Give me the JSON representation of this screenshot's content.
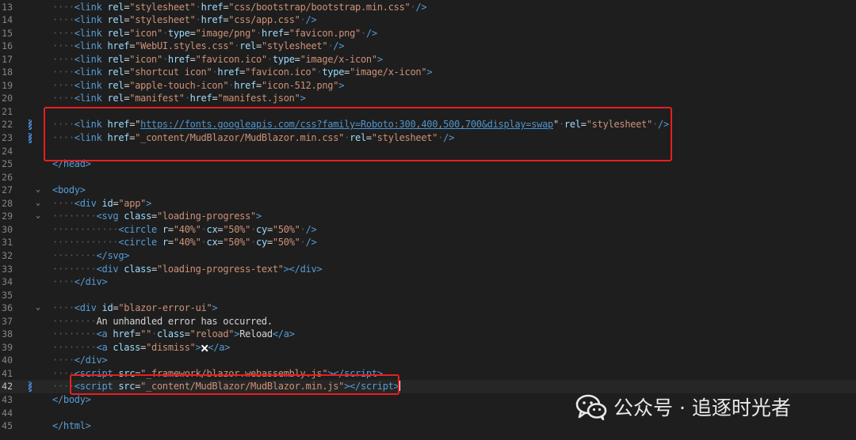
{
  "editor": {
    "lines": [
      {
        "num": "13",
        "mod": false,
        "fold": "",
        "ind": 1,
        "tokens": [
          [
            "b",
            "<"
          ],
          [
            "b",
            "link "
          ],
          [
            "an",
            "rel"
          ],
          [
            "t",
            "="
          ],
          [
            "av",
            "\"stylesheet\""
          ],
          [
            "w",
            "·"
          ],
          [
            "an",
            "href"
          ],
          [
            "t",
            "="
          ],
          [
            "av",
            "\"css/bootstrap/bootstrap.min.css\""
          ],
          [
            "w",
            "·"
          ],
          [
            "b",
            "/>"
          ]
        ]
      },
      {
        "num": "14",
        "mod": false,
        "fold": "",
        "ind": 1,
        "tokens": [
          [
            "b",
            "<"
          ],
          [
            "b",
            "link "
          ],
          [
            "an",
            "rel"
          ],
          [
            "t",
            "="
          ],
          [
            "av",
            "\"stylesheet\""
          ],
          [
            "w",
            "·"
          ],
          [
            "an",
            "href"
          ],
          [
            "t",
            "="
          ],
          [
            "av",
            "\"css/app.css\""
          ],
          [
            "w",
            "·"
          ],
          [
            "b",
            "/>"
          ]
        ]
      },
      {
        "num": "15",
        "mod": false,
        "fold": "",
        "ind": 1,
        "tokens": [
          [
            "b",
            "<"
          ],
          [
            "b",
            "link "
          ],
          [
            "an",
            "rel"
          ],
          [
            "t",
            "="
          ],
          [
            "av",
            "\"icon\""
          ],
          [
            "w",
            "·"
          ],
          [
            "an",
            "type"
          ],
          [
            "t",
            "="
          ],
          [
            "av",
            "\"image/png\""
          ],
          [
            "w",
            "·"
          ],
          [
            "an",
            "href"
          ],
          [
            "t",
            "="
          ],
          [
            "av",
            "\"favicon.png\""
          ],
          [
            "w",
            "·"
          ],
          [
            "b",
            "/>"
          ]
        ]
      },
      {
        "num": "16",
        "mod": false,
        "fold": "",
        "ind": 1,
        "tokens": [
          [
            "b",
            "<"
          ],
          [
            "b",
            "link "
          ],
          [
            "an",
            "href"
          ],
          [
            "t",
            "="
          ],
          [
            "av",
            "\"WebUI.styles.css\""
          ],
          [
            "w",
            "·"
          ],
          [
            "an",
            "rel"
          ],
          [
            "t",
            "="
          ],
          [
            "av",
            "\"stylesheet\""
          ],
          [
            "w",
            "·"
          ],
          [
            "b",
            "/>"
          ]
        ]
      },
      {
        "num": "17",
        "mod": false,
        "fold": "",
        "ind": 1,
        "tokens": [
          [
            "b",
            "<"
          ],
          [
            "b",
            "link "
          ],
          [
            "an",
            "rel"
          ],
          [
            "t",
            "="
          ],
          [
            "av",
            "\"icon\""
          ],
          [
            "w",
            "·"
          ],
          [
            "an",
            "href"
          ],
          [
            "t",
            "="
          ],
          [
            "av",
            "\"favicon.ico\""
          ],
          [
            "w",
            "·"
          ],
          [
            "an",
            "type"
          ],
          [
            "t",
            "="
          ],
          [
            "av",
            "\"image/x-icon\""
          ],
          [
            "b",
            ">"
          ]
        ]
      },
      {
        "num": "18",
        "mod": false,
        "fold": "",
        "ind": 1,
        "tokens": [
          [
            "b",
            "<"
          ],
          [
            "b",
            "link "
          ],
          [
            "an",
            "rel"
          ],
          [
            "t",
            "="
          ],
          [
            "av",
            "\"shortcut icon\""
          ],
          [
            "w",
            "·"
          ],
          [
            "an",
            "href"
          ],
          [
            "t",
            "="
          ],
          [
            "av",
            "\"favicon.ico\""
          ],
          [
            "w",
            "·"
          ],
          [
            "an",
            "type"
          ],
          [
            "t",
            "="
          ],
          [
            "av",
            "\"image/x-icon\""
          ],
          [
            "b",
            ">"
          ]
        ]
      },
      {
        "num": "19",
        "mod": false,
        "fold": "",
        "ind": 1,
        "tokens": [
          [
            "b",
            "<"
          ],
          [
            "b",
            "link "
          ],
          [
            "an",
            "rel"
          ],
          [
            "t",
            "="
          ],
          [
            "av",
            "\"apple-touch-icon\""
          ],
          [
            "w",
            "·"
          ],
          [
            "an",
            "href"
          ],
          [
            "t",
            "="
          ],
          [
            "av",
            "\"icon-512.png\""
          ],
          [
            "b",
            ">"
          ]
        ]
      },
      {
        "num": "20",
        "mod": false,
        "fold": "",
        "ind": 1,
        "tokens": [
          [
            "b",
            "<"
          ],
          [
            "b",
            "link "
          ],
          [
            "an",
            "rel"
          ],
          [
            "t",
            "="
          ],
          [
            "av",
            "\"manifest\""
          ],
          [
            "w",
            "·"
          ],
          [
            "an",
            "href"
          ],
          [
            "t",
            "="
          ],
          [
            "av",
            "\"manifest.json\""
          ],
          [
            "b",
            ">"
          ]
        ]
      },
      {
        "num": "21",
        "mod": false,
        "fold": "",
        "ind": 0,
        "tokens": []
      },
      {
        "num": "22",
        "mod": true,
        "fold": "",
        "ind": 1,
        "tokens": [
          [
            "b",
            "<"
          ],
          [
            "b",
            "link "
          ],
          [
            "an",
            "href"
          ],
          [
            "t",
            "="
          ],
          [
            "t",
            "\""
          ],
          [
            "u",
            "https://fonts.googleapis.com/css?family=Roboto:300,400,500,700&display=swap"
          ],
          [
            "t",
            "\""
          ],
          [
            "w",
            "·"
          ],
          [
            "an",
            "rel"
          ],
          [
            "t",
            "="
          ],
          [
            "av",
            "\"stylesheet\""
          ],
          [
            "w",
            "·"
          ],
          [
            "b",
            "/>"
          ]
        ]
      },
      {
        "num": "23",
        "mod": true,
        "fold": "",
        "ind": 1,
        "tokens": [
          [
            "b",
            "<"
          ],
          [
            "b",
            "link "
          ],
          [
            "an",
            "href"
          ],
          [
            "t",
            "="
          ],
          [
            "av",
            "\"_content/MudBlazor/MudBlazor.min.css\""
          ],
          [
            "w",
            "·"
          ],
          [
            "an",
            "rel"
          ],
          [
            "t",
            "="
          ],
          [
            "av",
            "\"stylesheet\""
          ],
          [
            "w",
            "·"
          ],
          [
            "b",
            "/>"
          ]
        ]
      },
      {
        "num": "24",
        "mod": false,
        "fold": "",
        "ind": 0,
        "tokens": []
      },
      {
        "num": "25",
        "mod": false,
        "fold": "",
        "ind": 0,
        "tokens": [
          [
            "b",
            "</"
          ],
          [
            "b",
            "head"
          ],
          [
            "b",
            ">"
          ]
        ]
      },
      {
        "num": "26",
        "mod": false,
        "fold": "",
        "ind": 0,
        "tokens": []
      },
      {
        "num": "27",
        "mod": false,
        "fold": "⌄",
        "ind": 0,
        "tokens": [
          [
            "b",
            "<"
          ],
          [
            "b",
            "body"
          ],
          [
            "b",
            ">"
          ]
        ]
      },
      {
        "num": "28",
        "mod": false,
        "fold": "⌄",
        "ind": 1,
        "tokens": [
          [
            "b",
            "<"
          ],
          [
            "b",
            "div "
          ],
          [
            "an",
            "id"
          ],
          [
            "t",
            "="
          ],
          [
            "av",
            "\"app\""
          ],
          [
            "b",
            ">"
          ]
        ]
      },
      {
        "num": "29",
        "mod": false,
        "fold": "⌄",
        "ind": 2,
        "tokens": [
          [
            "b",
            "<"
          ],
          [
            "b",
            "svg "
          ],
          [
            "an",
            "class"
          ],
          [
            "t",
            "="
          ],
          [
            "av",
            "\"loading-progress\""
          ],
          [
            "b",
            ">"
          ]
        ]
      },
      {
        "num": "30",
        "mod": false,
        "fold": "",
        "ind": 3,
        "tokens": [
          [
            "b",
            "<"
          ],
          [
            "b",
            "circle "
          ],
          [
            "an",
            "r"
          ],
          [
            "t",
            "="
          ],
          [
            "av",
            "\"40%\""
          ],
          [
            "w",
            "·"
          ],
          [
            "an",
            "cx"
          ],
          [
            "t",
            "="
          ],
          [
            "av",
            "\"50%\""
          ],
          [
            "w",
            "·"
          ],
          [
            "an",
            "cy"
          ],
          [
            "t",
            "="
          ],
          [
            "av",
            "\"50%\""
          ],
          [
            "w",
            "·"
          ],
          [
            "b",
            "/>"
          ]
        ]
      },
      {
        "num": "31",
        "mod": false,
        "fold": "",
        "ind": 3,
        "tokens": [
          [
            "b",
            "<"
          ],
          [
            "b",
            "circle "
          ],
          [
            "an",
            "r"
          ],
          [
            "t",
            "="
          ],
          [
            "av",
            "\"40%\""
          ],
          [
            "w",
            "·"
          ],
          [
            "an",
            "cx"
          ],
          [
            "t",
            "="
          ],
          [
            "av",
            "\"50%\""
          ],
          [
            "w",
            "·"
          ],
          [
            "an",
            "cy"
          ],
          [
            "t",
            "="
          ],
          [
            "av",
            "\"50%\""
          ],
          [
            "w",
            "·"
          ],
          [
            "b",
            "/>"
          ]
        ]
      },
      {
        "num": "32",
        "mod": false,
        "fold": "",
        "ind": 2,
        "tokens": [
          [
            "b",
            "</"
          ],
          [
            "b",
            "svg"
          ],
          [
            "b",
            ">"
          ]
        ]
      },
      {
        "num": "33",
        "mod": false,
        "fold": "",
        "ind": 2,
        "tokens": [
          [
            "b",
            "<"
          ],
          [
            "b",
            "div "
          ],
          [
            "an",
            "class"
          ],
          [
            "t",
            "="
          ],
          [
            "av",
            "\"loading-progress-text\""
          ],
          [
            "b",
            "></"
          ],
          [
            "b",
            "div"
          ],
          [
            "b",
            ">"
          ]
        ]
      },
      {
        "num": "34",
        "mod": false,
        "fold": "",
        "ind": 1,
        "tokens": [
          [
            "b",
            "</"
          ],
          [
            "b",
            "div"
          ],
          [
            "b",
            ">"
          ]
        ]
      },
      {
        "num": "35",
        "mod": false,
        "fold": "",
        "ind": 0,
        "tokens": []
      },
      {
        "num": "36",
        "mod": false,
        "fold": "⌄",
        "ind": 1,
        "tokens": [
          [
            "b",
            "<"
          ],
          [
            "b",
            "div "
          ],
          [
            "an",
            "id"
          ],
          [
            "t",
            "="
          ],
          [
            "av",
            "\"blazor-error-ui\""
          ],
          [
            "b",
            ">"
          ]
        ]
      },
      {
        "num": "37",
        "mod": false,
        "fold": "",
        "ind": 2,
        "tokens": [
          [
            "t",
            "An unhandled error has occurred."
          ]
        ]
      },
      {
        "num": "38",
        "mod": false,
        "fold": "",
        "ind": 2,
        "tokens": [
          [
            "b",
            "<"
          ],
          [
            "b",
            "a "
          ],
          [
            "an",
            "href"
          ],
          [
            "t",
            "="
          ],
          [
            "av",
            "\"\""
          ],
          [
            "w",
            "·"
          ],
          [
            "an",
            "class"
          ],
          [
            "t",
            "="
          ],
          [
            "av",
            "\"reload\""
          ],
          [
            "b",
            ">"
          ],
          [
            "t",
            "Reload"
          ],
          [
            "b",
            "</"
          ],
          [
            "b",
            "a"
          ],
          [
            "b",
            ">"
          ]
        ]
      },
      {
        "num": "39",
        "mod": false,
        "fold": "",
        "ind": 2,
        "tokens": [
          [
            "b",
            "<"
          ],
          [
            "b",
            "a "
          ],
          [
            "an",
            "class"
          ],
          [
            "t",
            "="
          ],
          [
            "av",
            "\"dismiss\""
          ],
          [
            "b",
            ">"
          ],
          [
            "x",
            "🗙"
          ],
          [
            "b",
            "</"
          ],
          [
            "b",
            "a"
          ],
          [
            "b",
            ">"
          ]
        ]
      },
      {
        "num": "40",
        "mod": false,
        "fold": "",
        "ind": 1,
        "tokens": [
          [
            "b",
            "</"
          ],
          [
            "b",
            "div"
          ],
          [
            "b",
            ">"
          ]
        ]
      },
      {
        "num": "41",
        "mod": false,
        "fold": "",
        "ind": 1,
        "tokens": [
          [
            "b",
            "<"
          ],
          [
            "b",
            "script "
          ],
          [
            "an",
            "src"
          ],
          [
            "t",
            "="
          ],
          [
            "av",
            "\"_framework/blazor.webassembly.js\""
          ],
          [
            "b",
            "></"
          ],
          [
            "b",
            "script"
          ],
          [
            "b",
            ">"
          ]
        ]
      },
      {
        "num": "42",
        "mod": true,
        "fold": "",
        "ind": 1,
        "current": true,
        "tokens": [
          [
            "b",
            "<"
          ],
          [
            "b",
            "script "
          ],
          [
            "an",
            "src"
          ],
          [
            "t",
            "="
          ],
          [
            "av",
            "\"_content/MudBlazor/MudBlazor.min.js\""
          ],
          [
            "b",
            "></"
          ],
          [
            "b",
            "script"
          ],
          [
            "b",
            ">"
          ],
          [
            "caret",
            ""
          ]
        ]
      },
      {
        "num": "43",
        "mod": false,
        "fold": "",
        "ind": 0,
        "tokens": [
          [
            "b",
            "</"
          ],
          [
            "b",
            "body"
          ],
          [
            "b",
            ">"
          ]
        ]
      },
      {
        "num": "44",
        "mod": false,
        "fold": "",
        "ind": 0,
        "tokens": []
      },
      {
        "num": "45",
        "mod": false,
        "fold": "",
        "ind": 0,
        "tokens": [
          [
            "b",
            "</"
          ],
          [
            "b",
            "html"
          ],
          [
            "b",
            ">"
          ]
        ]
      }
    ]
  },
  "watermark": {
    "label": "公众号 · 追逐时光者",
    "icon": "wechat-icon"
  },
  "colors": {
    "background": "#1e1e1e",
    "tag": "#569cd6",
    "attribute": "#9cdcfe",
    "string": "#ce9178",
    "highlight_box": "#e81f1f"
  }
}
